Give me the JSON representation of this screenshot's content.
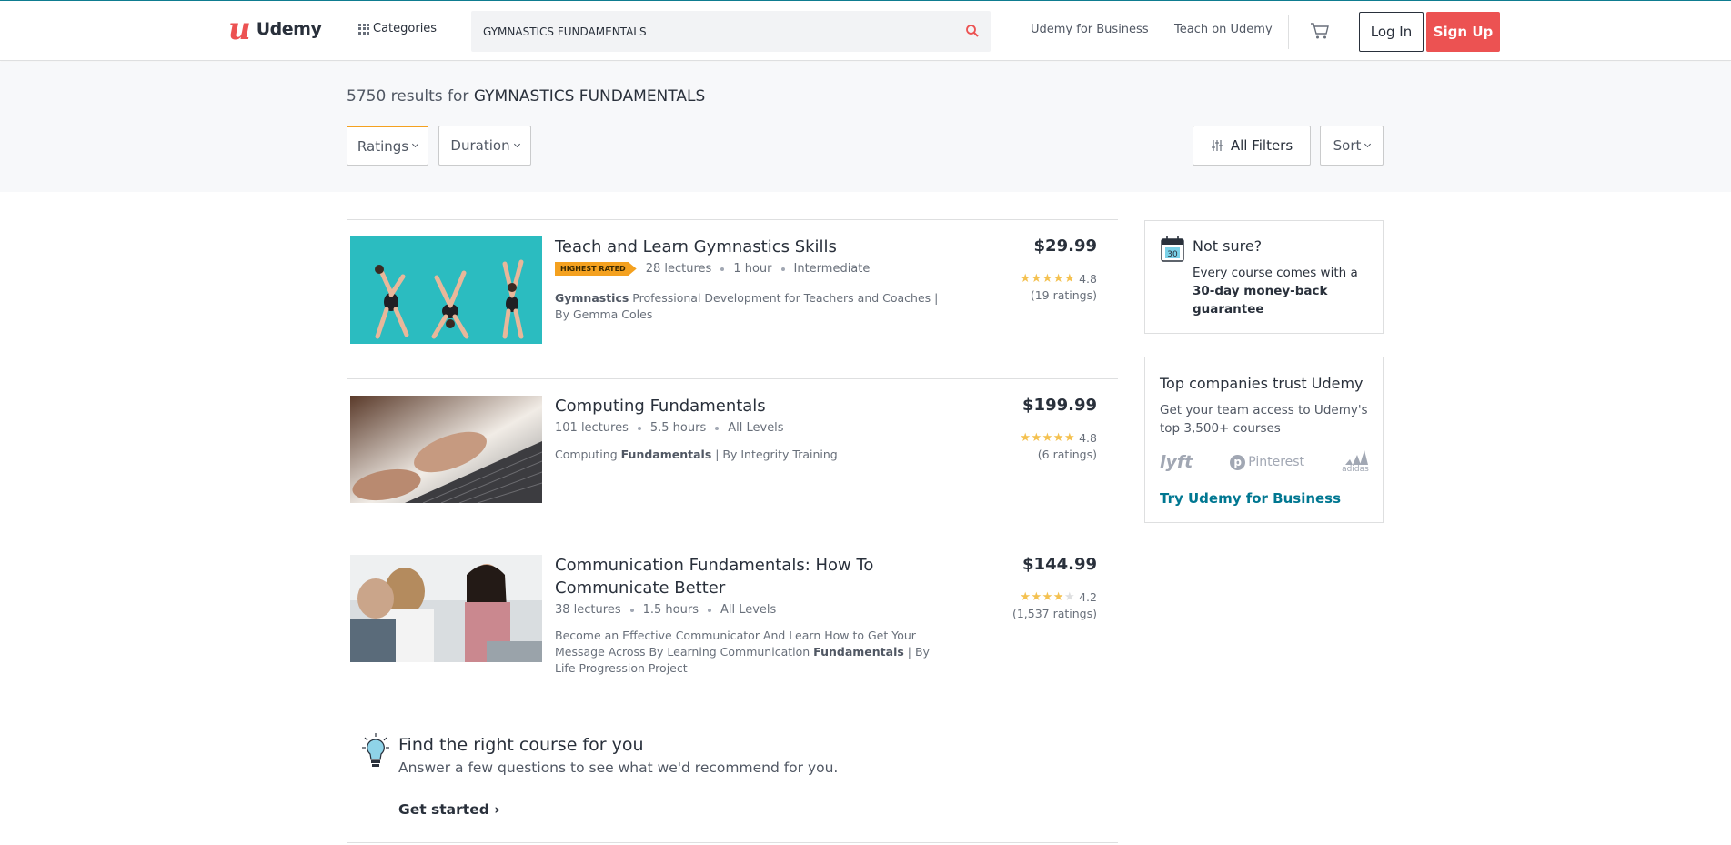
{
  "header": {
    "logo_text": "Udemy",
    "categories_label": "Categories",
    "search_value": "GYMNASTICS FUNDAMENTALS",
    "business_link": "Udemy for Business",
    "teach_link": "Teach on Udemy",
    "login_label": "Log In",
    "signup_label": "Sign Up"
  },
  "results": {
    "count_text": "5750 results for",
    "query": "GYMNASTICS FUNDAMENTALS"
  },
  "filters": {
    "ratings": "Ratings",
    "duration": "Duration",
    "all_filters": "All Filters",
    "sort": "Sort"
  },
  "courses": [
    {
      "title": "Teach and Learn Gymnastics Skills",
      "badge": "Highest rated",
      "lectures": "28 lectures",
      "duration": "1 hour",
      "level": "Intermediate",
      "desc_bold": "Gymnastics",
      "desc_rest": " Professional Development for Teachers and Coaches | By Gemma Coles",
      "price": "$29.99",
      "rating": "4.8",
      "stars": 4.8,
      "ratings_count": "(19 ratings)"
    },
    {
      "title": "Computing Fundamentals",
      "lectures": "101 lectures",
      "duration": "5.5 hours",
      "level": "All Levels",
      "desc_pre": "Computing ",
      "desc_bold": "Fundamentals",
      "desc_rest": " | By Integrity Training",
      "price": "$199.99",
      "rating": "4.8",
      "stars": 4.8,
      "ratings_count": "(6 ratings)"
    },
    {
      "title": "Communication Fundamentals: How To Communicate Better",
      "lectures": "38 lectures",
      "duration": "1.5 hours",
      "level": "All Levels",
      "desc_pre": "Become an Effective Communicator And Learn How to Get Your Message Across By Learning Communication ",
      "desc_bold": "Fundamentals",
      "desc_rest": " | By Life Progression Project",
      "price": "$144.99",
      "rating": "4.2",
      "stars": 4.2,
      "ratings_count": "(1,537 ratings)"
    }
  ],
  "finder": {
    "title": "Find the right course for you",
    "subtitle": "Answer a few questions to see what we'd recommend for you.",
    "cta": "Get started"
  },
  "not_sure": {
    "calendar_number": "30",
    "title": "Not sure?",
    "body_pre": "Every course comes with a ",
    "body_bold": "30-day money-back guarantee"
  },
  "companies": {
    "title": "Top companies trust Udemy",
    "body": "Get your team access to Udemy's top 3,500+ courses",
    "logo_lyft": "lyft",
    "logo_pinterest": "Pinterest",
    "logo_adidas": "adidas",
    "link": "Try Udemy for Business"
  },
  "colors": {
    "brand": "#ec5252",
    "star": "#f4c150",
    "badge": "#f4a11f",
    "link": "#007791"
  }
}
